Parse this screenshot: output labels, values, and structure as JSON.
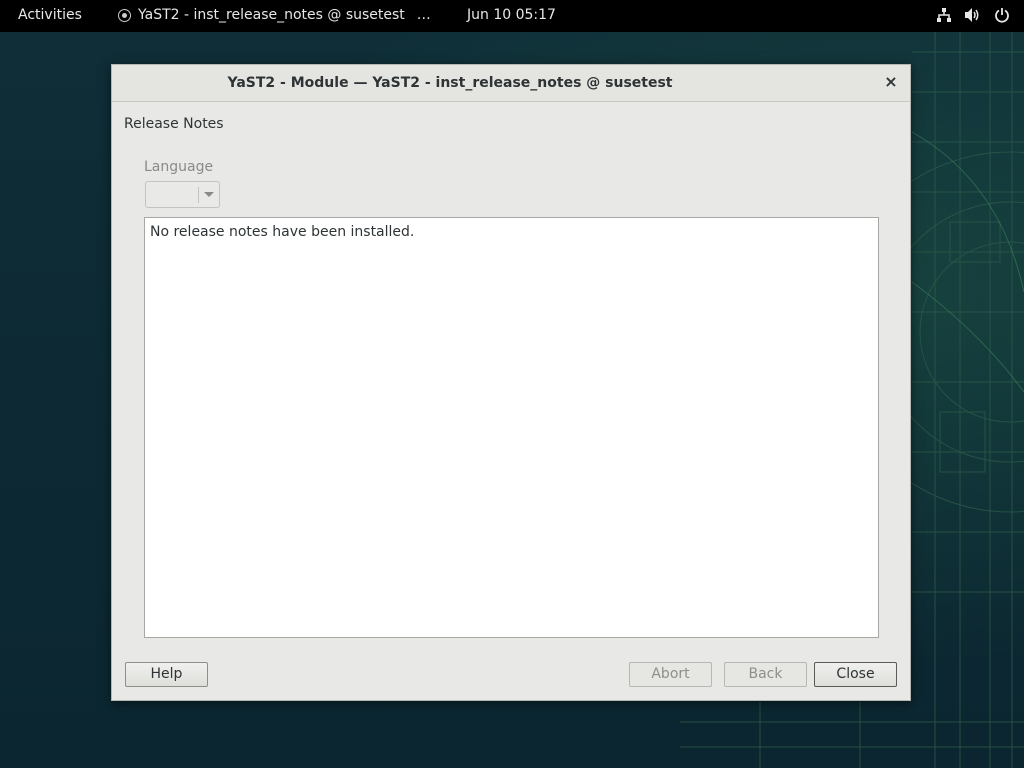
{
  "topbar": {
    "activities": "Activities",
    "app_title": "YaST2 - inst_release_notes @ susetest",
    "app_more": "…",
    "clock": "Jun 10  05:17",
    "tray_icons": [
      "network-icon",
      "volume-icon",
      "power-icon"
    ]
  },
  "dialog": {
    "title": "YaST2 - Module — YaST2 - inst_release_notes @ susetest",
    "close_glyph": "×",
    "heading": "Release Notes",
    "language_label": "Language",
    "language_value": "",
    "notes_text": "No release notes have been installed.",
    "buttons": {
      "help": "Help",
      "abort": "Abort",
      "back": "Back",
      "close": "Close"
    }
  },
  "colors": {
    "topbar": "#000000",
    "desktop": "#0d2a33",
    "dialog_bg": "#e8e8e6"
  }
}
